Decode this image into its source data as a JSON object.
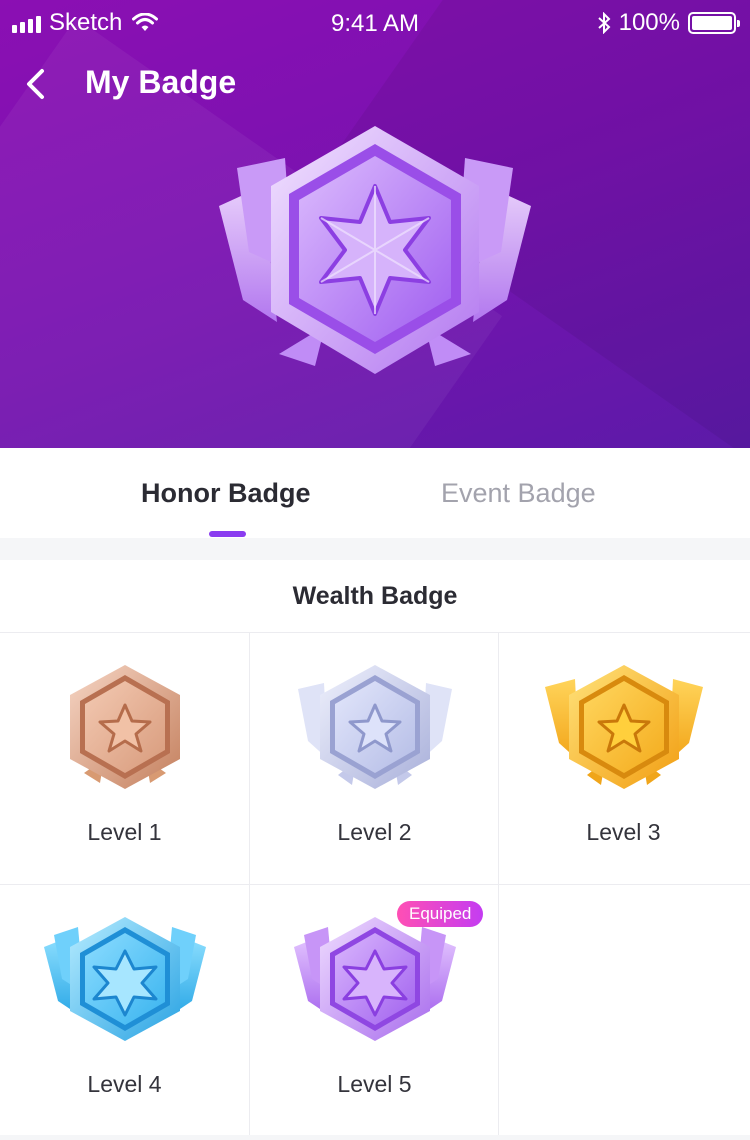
{
  "status_bar": {
    "carrier": "Sketch",
    "time": "9:41 AM",
    "battery": "100%"
  },
  "header": {
    "title": "My Badge"
  },
  "tabs": [
    {
      "label": "Honor Badge",
      "active": true
    },
    {
      "label": "Event Badge",
      "active": false
    }
  ],
  "section": {
    "title": "Wealth Badge",
    "badges": [
      {
        "label": "Level 1",
        "tier": "bronze"
      },
      {
        "label": "Level 2",
        "tier": "silver"
      },
      {
        "label": "Level 3",
        "tier": "gold"
      },
      {
        "label": "Level 4",
        "tier": "diamond"
      },
      {
        "label": "Level 5",
        "tier": "amethyst",
        "tag": "Equiped"
      }
    ]
  },
  "colors": {
    "hero_start": "#8b0fb3",
    "hero_end": "#5c1aa8",
    "accent": "#8a3cf0",
    "bronze": "#d08f6f",
    "silver": "#b6bde6",
    "gold": "#f3b02a",
    "diamond": "#35b6ee",
    "amethyst": "#b57cf2"
  }
}
